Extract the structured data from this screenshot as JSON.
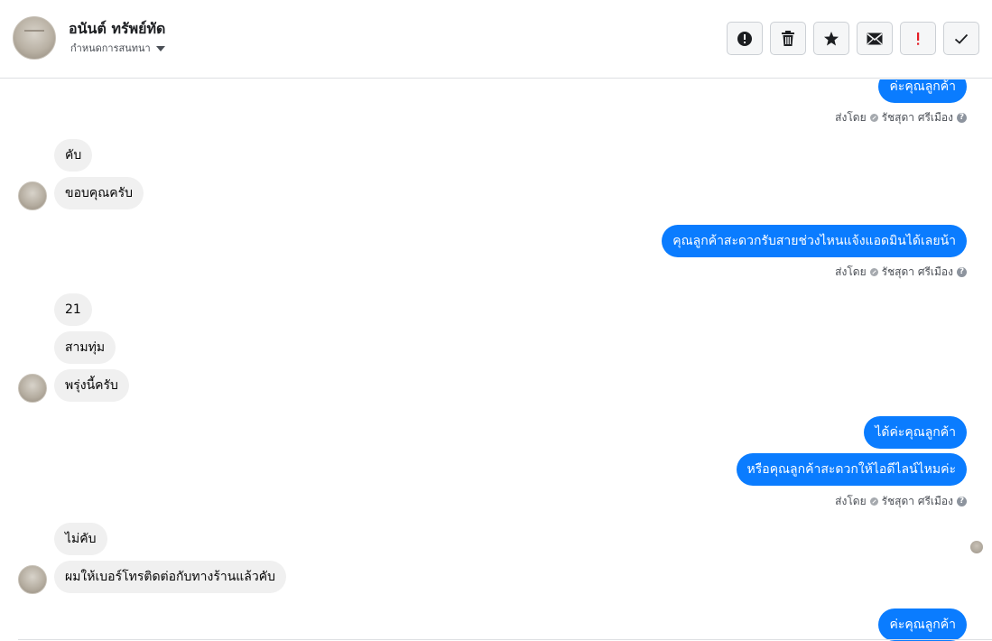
{
  "header": {
    "contact_name": "อนันต์ ทรัพย์ทัด",
    "assign_label": "กำหนดการสนทนา",
    "buttons": [
      {
        "name": "mark-spam",
        "icon": "alert-circle-icon"
      },
      {
        "name": "delete",
        "icon": "trash-icon"
      },
      {
        "name": "star",
        "icon": "star-icon"
      },
      {
        "name": "mark-unread",
        "icon": "envelope-icon"
      },
      {
        "name": "follow-up",
        "icon": "exclamation-icon"
      },
      {
        "name": "mark-done",
        "icon": "check-icon"
      }
    ]
  },
  "messages": {
    "m1": "ค่ะคุณลูกค้า",
    "m2": "คับ",
    "m3": "ขอบคุณครับ",
    "m4": "คุณลูกค้าสะดวกรับสายช่วงไหนแจ้งแอดมินได้เลยน้า",
    "m5": "21",
    "m6": "สามทุ่ม",
    "m7": "พรุ่งนี้ครับ",
    "m8": "ได้ค่ะคุณลูกค้า",
    "m9": "หรือคุณลูกค้าสะดวกให้ไอดีไลน์ไหมค่ะ",
    "m10": "ไม่คับ",
    "m11": "ผมให้เบอร์โทรติดต่อกับทางร้านแล้วคับ",
    "m12": "ค่ะคุณลูกค้า"
  },
  "sent_by": {
    "prefix": "ส่งโดย",
    "agent": "รัชสุดา ศรีเมือง"
  },
  "colors": {
    "outgoing_bubble": "#0a7cff",
    "incoming_bubble": "#f0f0f0"
  }
}
